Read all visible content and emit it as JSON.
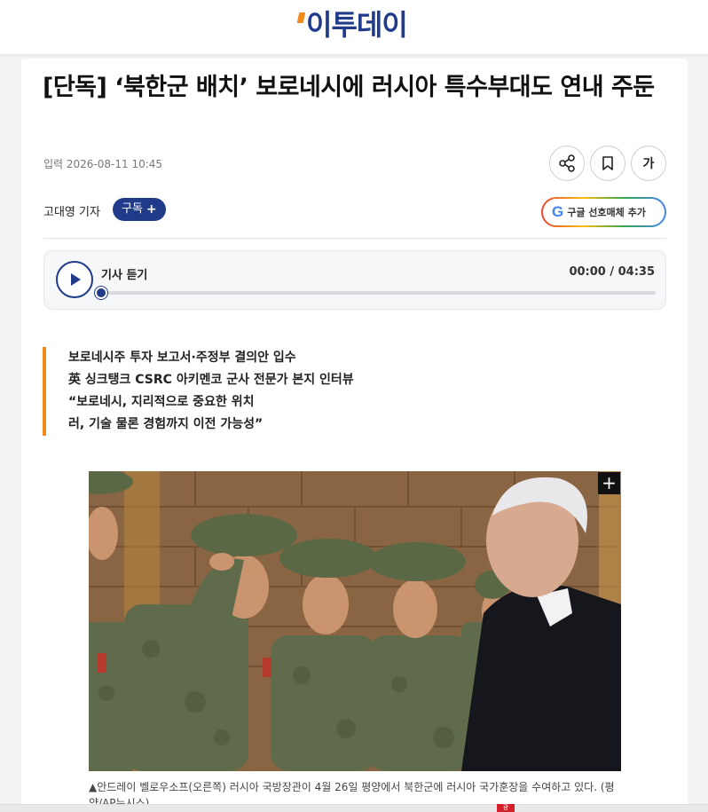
{
  "site": {
    "logo_text": "이투데이"
  },
  "article": {
    "title": "[단독] ‘북한군 배치’ 보로네시에 러시아 특수부대도 연내 주둔",
    "date": "입력 2026-08-11 10:45",
    "reporter": "고대영 기자",
    "subscribe_label": "구독",
    "font_label": "가",
    "google_pref_label": "구글 선호매체 추가"
  },
  "player": {
    "label": "기사 듣기",
    "time": "00:00 / 04:35",
    "progress": 0.0
  },
  "summary": [
    "보로네시주 투자 보고서·주정부 결의안 입수",
    "英 싱크탱크 CSRC 아키멘코 군사 전문가 본지 인터뷰",
    "“보로네시, 지리적으로 중요한 위치",
    "러, 기술 물론 경험까지 이전 가능성”"
  ],
  "photo": {
    "caption": "▲안드레이 벨로우소프(오른쪽) 러시아 국방장관이 4월 26일 평양에서 북한군에 러시아 국가훈장을 수여하고 있다. (평양/AP뉴시스)"
  },
  "icons": {
    "share": "share-icon",
    "bookmark": "bookmark-icon",
    "play": "play-icon",
    "zoom": "plus-icon"
  },
  "colors": {
    "brand_navy": "#1f3b8a",
    "accent_orange": "#f08a1c"
  }
}
